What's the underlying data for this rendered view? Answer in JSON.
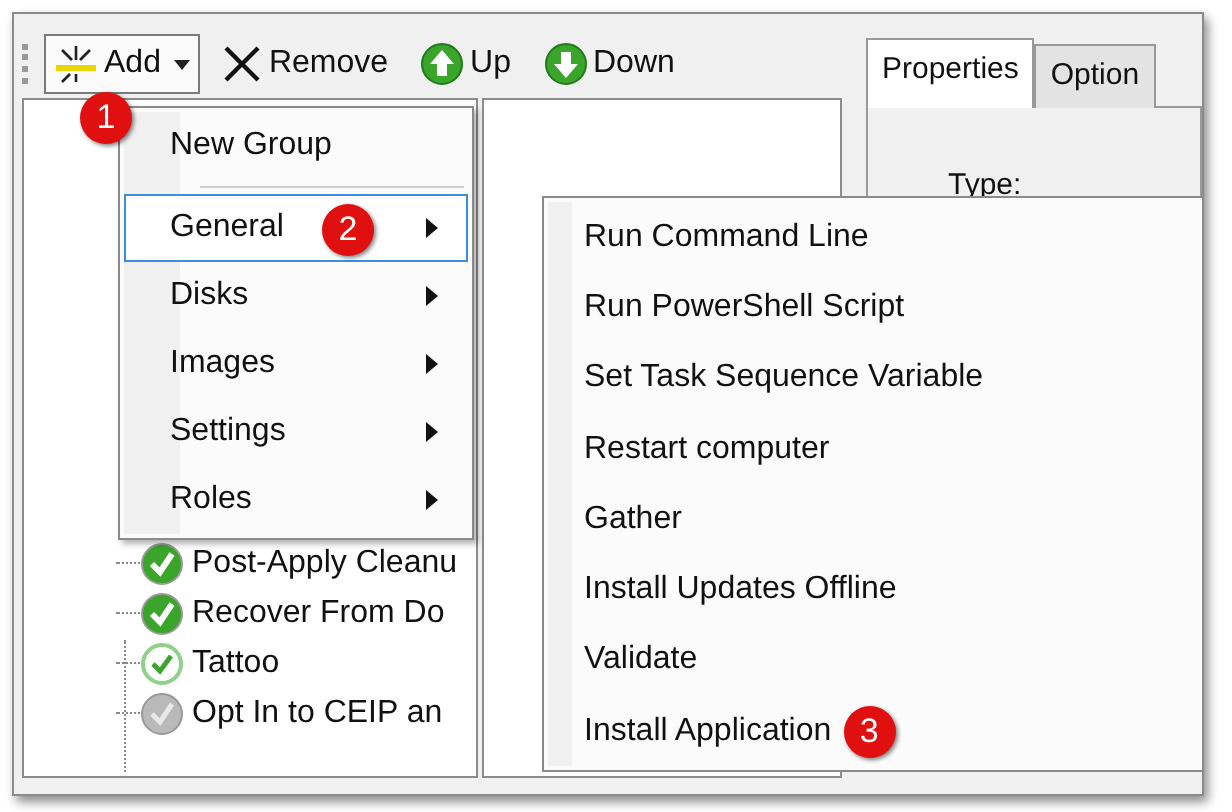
{
  "toolbar": {
    "buttons": [
      {
        "label": "Add",
        "kind": "add",
        "pressed": true,
        "callout": "1"
      },
      {
        "label": "Remove",
        "kind": "remove",
        "pressed": false
      },
      {
        "label": "Up",
        "kind": "up",
        "pressed": false
      },
      {
        "label": "Down",
        "kind": "down",
        "pressed": false
      }
    ]
  },
  "tabs": [
    {
      "label": "Properties",
      "selected": true
    },
    {
      "label": "Option",
      "selected": false
    }
  ],
  "properties": {
    "type_label": "Type:"
  },
  "tree": {
    "items": [
      {
        "label": "Post-Apply Cleanu",
        "kind": "success"
      },
      {
        "label": "Recover From Do",
        "kind": "success"
      },
      {
        "label": "Tattoo",
        "kind": "done"
      },
      {
        "label": "Opt In to CEIP an",
        "kind": "disabled"
      }
    ]
  },
  "add_menu": {
    "items": [
      {
        "kind": "item",
        "label": "New Group",
        "submenu": false,
        "selected": false
      },
      {
        "kind": "separator"
      },
      {
        "kind": "item",
        "label": "General",
        "submenu": true,
        "selected": true,
        "callout": "2"
      },
      {
        "kind": "item",
        "label": "Disks",
        "submenu": true,
        "selected": false
      },
      {
        "kind": "item",
        "label": "Images",
        "submenu": true,
        "selected": false
      },
      {
        "kind": "item",
        "label": "Settings",
        "submenu": true,
        "selected": false
      },
      {
        "kind": "item",
        "label": "Roles",
        "submenu": true,
        "selected": false
      }
    ]
  },
  "general_menu": {
    "items": [
      {
        "label": "Run Command Line"
      },
      {
        "label": "Run PowerShell Script"
      },
      {
        "label": "Set Task Sequence Variable"
      },
      {
        "label": "Restart computer"
      },
      {
        "label": "Gather"
      },
      {
        "label": "Install Updates Offline"
      },
      {
        "label": "Validate"
      },
      {
        "label": "Install Application",
        "callout": "3"
      }
    ]
  }
}
